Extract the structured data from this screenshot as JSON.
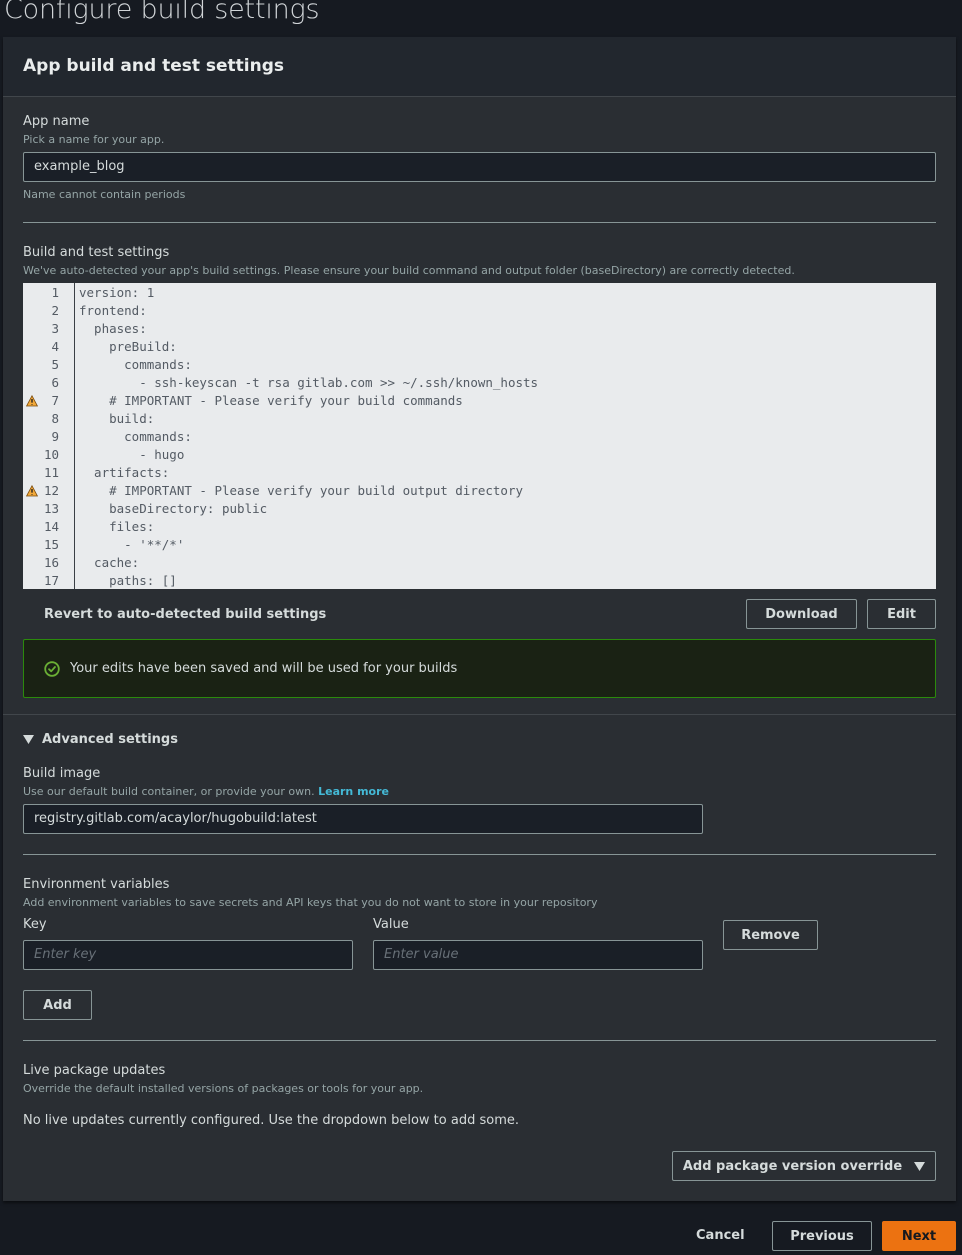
{
  "page": {
    "title": "Configure build settings"
  },
  "card": {
    "title": "App build and test settings"
  },
  "app_name": {
    "label": "App name",
    "description": "Pick a name for your app.",
    "value": "example_blog",
    "constraint": "Name cannot contain periods"
  },
  "build_settings": {
    "label": "Build and test settings",
    "description": "We've auto-detected your app's build settings. Please ensure your build command and output folder (baseDirectory) are correctly detected.",
    "code_lines": [
      {
        "n": "1",
        "text": "version: 1",
        "warning": false
      },
      {
        "n": "2",
        "text": "frontend:",
        "warning": false
      },
      {
        "n": "3",
        "text": "  phases:",
        "warning": false
      },
      {
        "n": "4",
        "text": "    preBuild:",
        "warning": false
      },
      {
        "n": "5",
        "text": "      commands:",
        "warning": false
      },
      {
        "n": "6",
        "text": "        - ssh-keyscan -t rsa gitlab.com >> ~/.ssh/known_hosts",
        "warning": false
      },
      {
        "n": "7",
        "text": "    # IMPORTANT - Please verify your build commands",
        "warning": true
      },
      {
        "n": "8",
        "text": "    build:",
        "warning": false
      },
      {
        "n": "9",
        "text": "      commands:",
        "warning": false
      },
      {
        "n": "10",
        "text": "        - hugo",
        "warning": false
      },
      {
        "n": "11",
        "text": "  artifacts:",
        "warning": false
      },
      {
        "n": "12",
        "text": "    # IMPORTANT - Please verify your build output directory",
        "warning": true
      },
      {
        "n": "13",
        "text": "    baseDirectory: public",
        "warning": false
      },
      {
        "n": "14",
        "text": "    files:",
        "warning": false
      },
      {
        "n": "15",
        "text": "      - '**/*'",
        "warning": false
      },
      {
        "n": "16",
        "text": "  cache:",
        "warning": false
      },
      {
        "n": "17",
        "text": "    paths: []",
        "warning": false
      }
    ],
    "revert_label": "Revert to auto-detected build settings",
    "download_label": "Download",
    "edit_label": "Edit",
    "success_message": "Your edits have been saved and will be used for your builds"
  },
  "advanced": {
    "toggle_label": "Advanced settings",
    "build_image": {
      "label": "Build image",
      "description": "Use our default build container, or provide your own.",
      "learn_more": "Learn more",
      "value": "registry.gitlab.com/acaylor/hugobuild:latest"
    },
    "env_vars": {
      "label": "Environment variables",
      "description": "Add environment variables to save secrets and API keys that you do not want to store in your repository",
      "key_label": "Key",
      "value_label": "Value",
      "key_placeholder": "Enter key",
      "value_placeholder": "Enter value",
      "remove_label": "Remove",
      "add_label": "Add"
    },
    "live_updates": {
      "label": "Live package updates",
      "description": "Override the default installed versions of packages or tools for your app.",
      "empty_message": "No live updates currently configured. Use the dropdown below to add some.",
      "dropdown_label": "Add package version override"
    }
  },
  "footer": {
    "cancel_label": "Cancel",
    "previous_label": "Previous",
    "next_label": "Next"
  },
  "colors": {
    "primary": "#ec7211",
    "success": "#6aaf35",
    "link": "#44b9d6",
    "warning": "#f2a93b"
  }
}
